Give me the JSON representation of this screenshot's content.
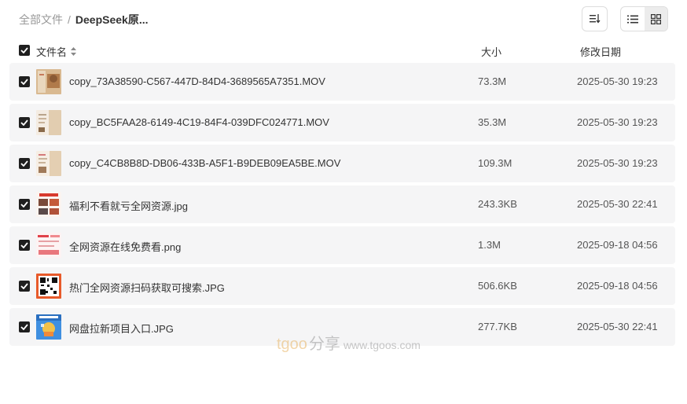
{
  "breadcrumb": {
    "root": "全部文件",
    "separator": "/",
    "current": "DeepSeek原..."
  },
  "toolbar": {
    "sort_icon": "sort-lines-icon",
    "view_list_icon": "list-view-icon",
    "view_grid_icon": "grid-view-icon",
    "active_view": "grid"
  },
  "header": {
    "name": "文件名",
    "size": "大小",
    "date": "修改日期"
  },
  "files": [
    {
      "name": "copy_73A38590-C567-447D-84D4-3689565A7351.MOV",
      "size": "73.3M",
      "date": "2025-05-30 19:23",
      "thumb": "video"
    },
    {
      "name": "copy_BC5FAA28-6149-4C19-84F4-039DFC024771.MOV",
      "size": "35.3M",
      "date": "2025-05-30 19:23",
      "thumb": "video"
    },
    {
      "name": "copy_C4CB8B8D-DB06-433B-A5F1-B9DEB09EA5BE.MOV",
      "size": "109.3M",
      "date": "2025-05-30 19:23",
      "thumb": "video"
    },
    {
      "name": "福利不看就亏全网资源.jpg",
      "size": "243.3KB",
      "date": "2025-05-30 22:41",
      "thumb": "image"
    },
    {
      "name": "全网资源在线免费看.png",
      "size": "1.3M",
      "date": "2025-09-18 04:56",
      "thumb": "image"
    },
    {
      "name": "热门全网资源扫码获取可搜索.JPG",
      "size": "506.6KB",
      "date": "2025-09-18 04:56",
      "thumb": "qr"
    },
    {
      "name": "网盘拉新项目入口.JPG",
      "size": "277.7KB",
      "date": "2025-05-30 22:41",
      "thumb": "poster"
    }
  ],
  "watermark": {
    "brand": "tgoo",
    "brand_cn": "分享",
    "url": "www.tgoos.com"
  },
  "colors": {
    "row_bg": "#f5f5f6",
    "checkbox": "#1f1f1f",
    "watermark": "#e8b565"
  }
}
